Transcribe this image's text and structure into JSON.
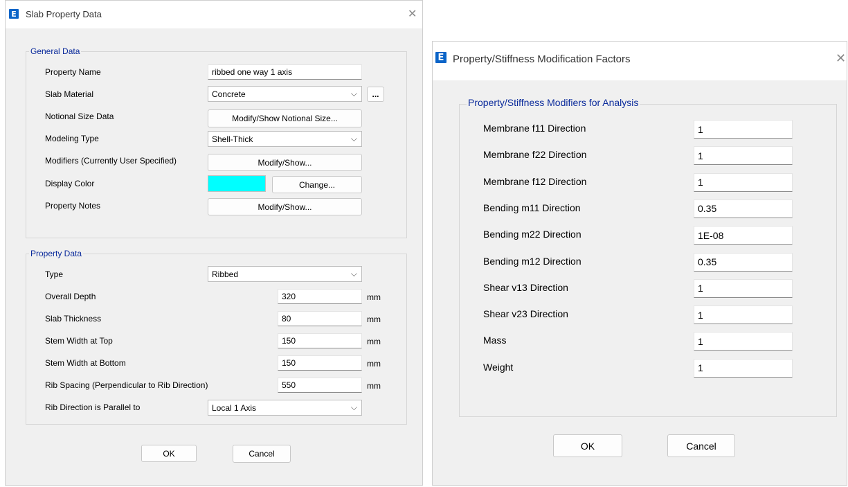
{
  "slab_dialog": {
    "title": "Slab Property Data",
    "app_icon_letter": "E",
    "close_glyph": "✕",
    "general": {
      "legend": "General Data",
      "property_name_label": "Property Name",
      "property_name_value": "ribbed one way 1 axis",
      "slab_material_label": "Slab Material",
      "slab_material_value": "Concrete",
      "slab_material_more": "...",
      "notional_label": "Notional Size Data",
      "notional_button": "Modify/Show Notional Size...",
      "modeling_type_label": "Modeling Type",
      "modeling_type_value": "Shell-Thick",
      "modifiers_label": "Modifiers (Currently User Specified)",
      "modifiers_button": "Modify/Show...",
      "display_color_label": "Display Color",
      "display_color_value": "#00ffff",
      "change_button": "Change...",
      "notes_label": "Property Notes",
      "notes_button": "Modify/Show..."
    },
    "property": {
      "legend": "Property Data",
      "type_label": "Type",
      "type_value": "Ribbed",
      "overall_depth_label": "Overall Depth",
      "overall_depth_value": "320",
      "slab_thickness_label": "Slab Thickness",
      "slab_thickness_value": "80",
      "stem_top_label": "Stem Width at Top",
      "stem_top_value": "150",
      "stem_bottom_label": "Stem Width at Bottom",
      "stem_bottom_value": "150",
      "rib_spacing_label": "Rib Spacing (Perpendicular to Rib Direction)",
      "rib_spacing_value": "550",
      "rib_direction_label": "Rib Direction is Parallel to",
      "rib_direction_value": "Local 1 Axis",
      "unit": "mm"
    },
    "ok": "OK",
    "cancel": "Cancel"
  },
  "modifiers_dialog": {
    "title": "Property/Stiffness Modification Factors",
    "app_icon_letter": "E",
    "close_glyph": "✕",
    "legend": "Property/Stiffness Modifiers for Analysis",
    "rows": [
      {
        "label": "Membrane f11 Direction",
        "value": "1"
      },
      {
        "label": "Membrane f22 Direction",
        "value": "1"
      },
      {
        "label": "Membrane f12 Direction",
        "value": "1"
      },
      {
        "label": "Bending m11 Direction",
        "value": "0.35"
      },
      {
        "label": "Bending m22 Direction",
        "value": "1E-08"
      },
      {
        "label": "Bending m12 Direction",
        "value": "0.35"
      },
      {
        "label": "Shear v13 Direction",
        "value": "1"
      },
      {
        "label": "Shear v23 Direction",
        "value": "1"
      },
      {
        "label": "Mass",
        "value": "1"
      },
      {
        "label": "Weight",
        "value": "1"
      }
    ],
    "ok": "OK",
    "cancel": "Cancel"
  },
  "colors": {
    "accent": "#0a64c8",
    "legend_text": "#0a2a9b",
    "dialog_bg": "#f0f0f0"
  }
}
